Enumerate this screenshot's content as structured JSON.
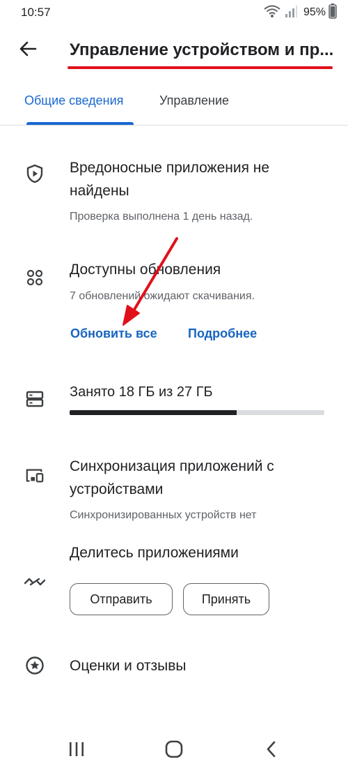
{
  "status_bar": {
    "time": "10:57",
    "battery": "95%"
  },
  "header": {
    "title": "Управление устройством и пр..."
  },
  "tabs": [
    {
      "label": "Общие сведения",
      "active": true
    },
    {
      "label": "Управление",
      "active": false
    }
  ],
  "security": {
    "title": "Вредоносные приложения не найдены",
    "subtitle": "Проверка выполнена 1 день назад."
  },
  "updates": {
    "title": "Доступны обновления",
    "subtitle": "7 обновлений ожидают скачивания.",
    "update_all": "Обновить все",
    "details": "Подробнее"
  },
  "storage": {
    "label": "Занято 18 ГБ из 27 ГБ",
    "used_fraction": 0.655
  },
  "sync": {
    "title": "Синхронизация приложений с устройствами",
    "subtitle": "Синхронизированных устройств нет"
  },
  "share": {
    "title": "Делитесь приложениями",
    "send": "Отправить",
    "receive": "Принять"
  },
  "ratings": {
    "title": "Оценки и отзывы"
  },
  "colors": {
    "accent": "#1967d2",
    "annotation_red": "#e0101a"
  }
}
